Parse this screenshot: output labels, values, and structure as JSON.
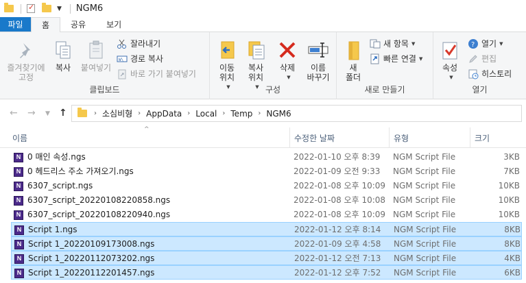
{
  "window": {
    "title": "NGM6"
  },
  "ribbon_tabs": [
    "파일",
    "홈",
    "공유",
    "보기"
  ],
  "clipboard": {
    "pin_label_1": "즐겨찾기에",
    "pin_label_2": "고정",
    "copy": "복사",
    "paste": "붙여넣기",
    "cut": "잘라내기",
    "copy_path": "경로 복사",
    "paste_shortcut": "바로 가기 붙여넣기",
    "group": "클립보드"
  },
  "organize": {
    "move_1": "이동",
    "move_2": "위치",
    "copyto_1": "복사",
    "copyto_2": "위치",
    "delete": "삭제",
    "rename_1": "이름",
    "rename_2": "바꾸기",
    "group": "구성"
  },
  "new": {
    "folder_1": "새",
    "folder_2": "폴더",
    "new_item": "새 항목",
    "easy_access": "빠른 연결",
    "group": "새로 만들기"
  },
  "open": {
    "properties": "속성",
    "open": "열기",
    "edit": "편집",
    "history": "히스토리",
    "group": "열기"
  },
  "breadcrumb": [
    "소심비형",
    "AppData",
    "Local",
    "Temp",
    "NGM6"
  ],
  "columns": {
    "name": "이름",
    "date": "수정한 날짜",
    "type": "유형",
    "size": "크기"
  },
  "files": [
    {
      "name": "0 매인 속성.ngs",
      "date": "2022-01-10 오후 8:39",
      "type": "NGM Script File",
      "size": "3KB",
      "selected": false
    },
    {
      "name": "0 헤드리스 주소 가져오기.ngs",
      "date": "2022-01-09 오전 9:33",
      "type": "NGM Script File",
      "size": "7KB",
      "selected": false
    },
    {
      "name": "6307_script.ngs",
      "date": "2022-01-08 오후 10:09",
      "type": "NGM Script File",
      "size": "10KB",
      "selected": false
    },
    {
      "name": "6307_script_20220108220858.ngs",
      "date": "2022-01-08 오후 10:08",
      "type": "NGM Script File",
      "size": "10KB",
      "selected": false
    },
    {
      "name": "6307_script_20220108220940.ngs",
      "date": "2022-01-08 오후 10:09",
      "type": "NGM Script File",
      "size": "10KB",
      "selected": false
    },
    {
      "name": "Script 1.ngs",
      "date": "2022-01-12 오후 8:14",
      "type": "NGM Script File",
      "size": "8KB",
      "selected": true
    },
    {
      "name": "Script 1_20220109173008.ngs",
      "date": "2022-01-09 오후 4:58",
      "type": "NGM Script File",
      "size": "8KB",
      "selected": true
    },
    {
      "name": "Script 1_20220112073202.ngs",
      "date": "2022-01-12 오전 7:13",
      "type": "NGM Script File",
      "size": "4KB",
      "selected": true
    },
    {
      "name": "Script 1_20220112201457.ngs",
      "date": "2022-01-12 오후 7:52",
      "type": "NGM Script File",
      "size": "6KB",
      "selected": true
    }
  ],
  "file_icon_letter": "N",
  "colors": {
    "selection": "#cce8ff",
    "file_tab": "#1979ca",
    "ngm_icon": "#4b2a8a"
  }
}
